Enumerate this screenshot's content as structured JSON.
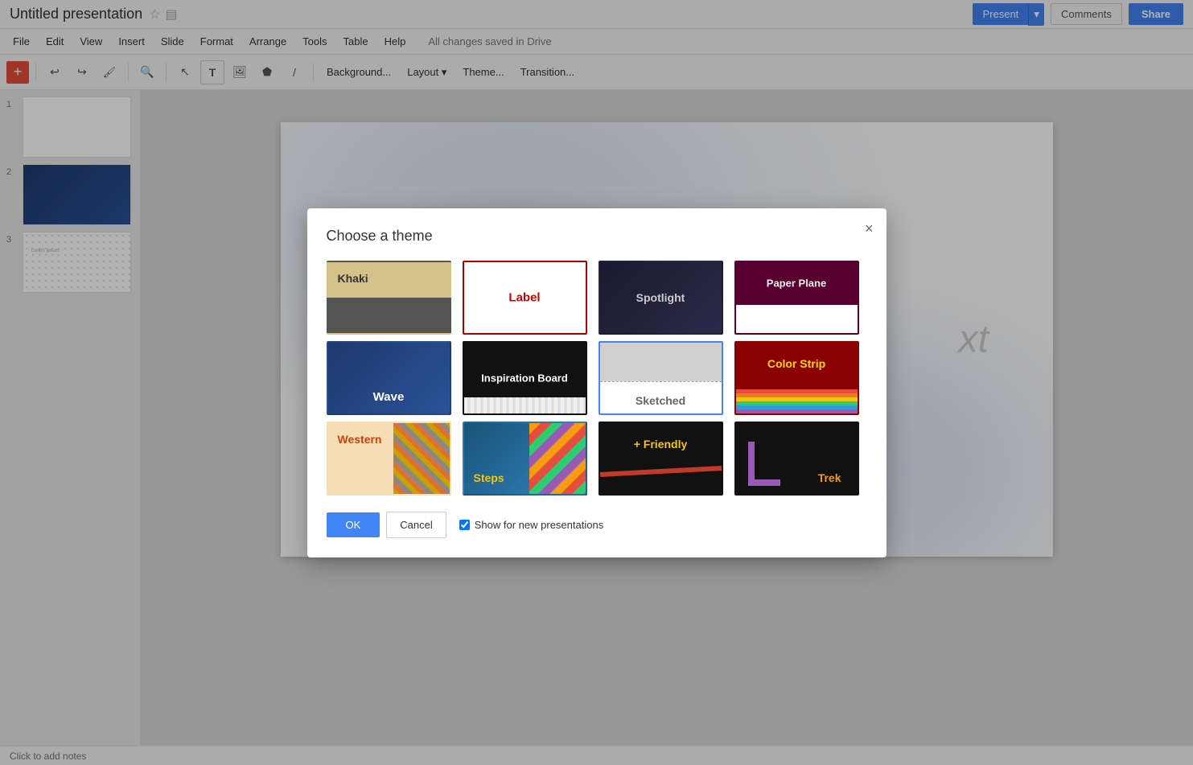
{
  "titlebar": {
    "title": "Untitled presentation",
    "star_icon": "☆",
    "folder_icon": "▤",
    "present_label": "Present",
    "dropdown_icon": "▾",
    "comments_label": "Comments",
    "share_label": "Share"
  },
  "menubar": {
    "items": [
      "File",
      "Edit",
      "View",
      "Insert",
      "Slide",
      "Format",
      "Arrange",
      "Tools",
      "Table",
      "Help"
    ],
    "status": "All changes saved in Drive"
  },
  "toolbar": {
    "add_icon": "+",
    "undo_icon": "↩",
    "redo_icon": "↪",
    "paint_icon": "🖌",
    "zoom_icon": "🔍",
    "cursor_icon": "↖",
    "textbox_icon": "T",
    "image_icon": "🖼",
    "shapes_icon": "⬟",
    "line_icon": "/",
    "background_label": "Background...",
    "layout_label": "Layout",
    "layout_icon": "▾",
    "theme_label": "Theme...",
    "transition_label": "Transition..."
  },
  "slides": [
    {
      "num": "1",
      "type": "blank"
    },
    {
      "num": "2",
      "type": "wave"
    },
    {
      "num": "3",
      "type": "dotted"
    }
  ],
  "notes": {
    "placeholder": "Click to add notes"
  },
  "dialog": {
    "title": "Choose a theme",
    "close_icon": "×",
    "themes": [
      {
        "id": "khaki",
        "name": "Khaki",
        "selected": false
      },
      {
        "id": "label",
        "name": "Label",
        "selected": false
      },
      {
        "id": "spotlight",
        "name": "Spotlight",
        "selected": false
      },
      {
        "id": "paper-plane",
        "name": "Paper Plane",
        "selected": false
      },
      {
        "id": "wave",
        "name": "Wave",
        "selected": false
      },
      {
        "id": "inspiration",
        "name": "Inspiration Board",
        "selected": false
      },
      {
        "id": "sketched",
        "name": "Sketched",
        "selected": true
      },
      {
        "id": "colorstrip",
        "name": "Color Strip",
        "selected": false
      },
      {
        "id": "western",
        "name": "Western",
        "selected": false
      },
      {
        "id": "steps",
        "name": "Steps",
        "selected": false
      },
      {
        "id": "friendly",
        "name": "+ Friendly",
        "selected": false
      },
      {
        "id": "trek",
        "name": "Trek",
        "selected": false
      }
    ],
    "ok_label": "OK",
    "cancel_label": "Cancel",
    "show_for_new": true,
    "show_for_new_label": "Show for new presentations"
  }
}
